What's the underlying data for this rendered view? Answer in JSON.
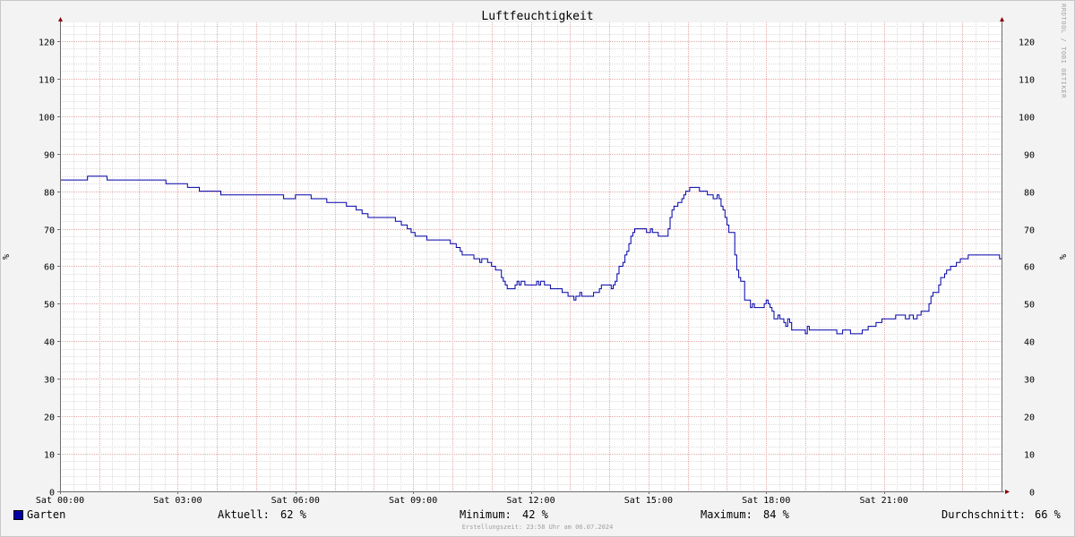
{
  "chart_data": {
    "type": "line",
    "title": "Luftfeuchtigkeit",
    "ylabel": "%",
    "y_ticks": [
      0,
      10,
      20,
      30,
      40,
      50,
      60,
      70,
      80,
      90,
      100,
      110,
      120
    ],
    "ylim": [
      0,
      125
    ],
    "xlim": [
      0,
      24
    ],
    "x_tick_labels": [
      "Sat 00:00",
      "Sat 03:00",
      "Sat 06:00",
      "Sat 09:00",
      "Sat 12:00",
      "Sat 15:00",
      "Sat 18:00",
      "Sat 21:00"
    ],
    "x_tick_hours": [
      0,
      3,
      6,
      9,
      12,
      15,
      18,
      21
    ],
    "grid": true,
    "series": [
      {
        "name": "Garten",
        "color": "#0000aa",
        "points": [
          [
            0.0,
            83
          ],
          [
            0.7,
            83
          ],
          [
            0.7,
            84
          ],
          [
            1.2,
            84
          ],
          [
            1.2,
            83
          ],
          [
            2.7,
            83
          ],
          [
            2.7,
            82
          ],
          [
            3.25,
            82
          ],
          [
            3.25,
            81
          ],
          [
            3.55,
            81
          ],
          [
            3.55,
            80
          ],
          [
            4.1,
            80
          ],
          [
            4.1,
            79
          ],
          [
            5.7,
            79
          ],
          [
            5.7,
            78
          ],
          [
            6.0,
            78
          ],
          [
            6.0,
            79
          ],
          [
            6.4,
            79
          ],
          [
            6.4,
            78
          ],
          [
            6.8,
            78
          ],
          [
            6.8,
            77
          ],
          [
            7.3,
            77
          ],
          [
            7.3,
            76
          ],
          [
            7.55,
            76
          ],
          [
            7.55,
            75
          ],
          [
            7.7,
            75
          ],
          [
            7.7,
            74
          ],
          [
            7.85,
            74
          ],
          [
            7.85,
            73
          ],
          [
            8.55,
            73
          ],
          [
            8.55,
            72
          ],
          [
            8.7,
            72
          ],
          [
            8.7,
            71
          ],
          [
            8.85,
            71
          ],
          [
            8.85,
            70
          ],
          [
            8.95,
            70
          ],
          [
            8.95,
            69
          ],
          [
            9.05,
            69
          ],
          [
            9.05,
            68
          ],
          [
            9.35,
            68
          ],
          [
            9.35,
            67
          ],
          [
            9.95,
            67
          ],
          [
            9.95,
            66
          ],
          [
            10.1,
            66
          ],
          [
            10.1,
            65
          ],
          [
            10.2,
            65
          ],
          [
            10.2,
            64
          ],
          [
            10.25,
            64
          ],
          [
            10.25,
            63
          ],
          [
            10.55,
            63
          ],
          [
            10.55,
            62
          ],
          [
            10.7,
            62
          ],
          [
            10.7,
            61
          ],
          [
            10.75,
            61
          ],
          [
            10.75,
            62
          ],
          [
            10.9,
            62
          ],
          [
            10.9,
            61
          ],
          [
            11.0,
            61
          ],
          [
            11.0,
            60
          ],
          [
            11.1,
            60
          ],
          [
            11.1,
            59
          ],
          [
            11.25,
            59
          ],
          [
            11.25,
            57
          ],
          [
            11.3,
            57
          ],
          [
            11.3,
            56
          ],
          [
            11.35,
            56
          ],
          [
            11.35,
            55
          ],
          [
            11.4,
            55
          ],
          [
            11.4,
            54
          ],
          [
            11.6,
            54
          ],
          [
            11.6,
            55
          ],
          [
            11.65,
            55
          ],
          [
            11.65,
            56
          ],
          [
            11.7,
            56
          ],
          [
            11.7,
            55
          ],
          [
            11.75,
            55
          ],
          [
            11.75,
            56
          ],
          [
            11.85,
            56
          ],
          [
            11.85,
            55
          ],
          [
            12.15,
            55
          ],
          [
            12.15,
            56
          ],
          [
            12.2,
            56
          ],
          [
            12.2,
            55
          ],
          [
            12.25,
            55
          ],
          [
            12.25,
            56
          ],
          [
            12.35,
            56
          ],
          [
            12.35,
            55
          ],
          [
            12.5,
            55
          ],
          [
            12.5,
            54
          ],
          [
            12.8,
            54
          ],
          [
            12.8,
            53
          ],
          [
            12.95,
            53
          ],
          [
            12.95,
            52
          ],
          [
            13.1,
            52
          ],
          [
            13.1,
            51
          ],
          [
            13.15,
            51
          ],
          [
            13.15,
            52
          ],
          [
            13.25,
            52
          ],
          [
            13.25,
            53
          ],
          [
            13.3,
            53
          ],
          [
            13.3,
            52
          ],
          [
            13.6,
            52
          ],
          [
            13.6,
            53
          ],
          [
            13.75,
            53
          ],
          [
            13.75,
            54
          ],
          [
            13.8,
            54
          ],
          [
            13.8,
            55
          ],
          [
            14.05,
            55
          ],
          [
            14.05,
            54
          ],
          [
            14.1,
            54
          ],
          [
            14.1,
            55
          ],
          [
            14.15,
            55
          ],
          [
            14.15,
            56
          ],
          [
            14.2,
            56
          ],
          [
            14.2,
            58
          ],
          [
            14.25,
            58
          ],
          [
            14.25,
            60
          ],
          [
            14.35,
            60
          ],
          [
            14.35,
            61
          ],
          [
            14.4,
            61
          ],
          [
            14.4,
            63
          ],
          [
            14.45,
            63
          ],
          [
            14.45,
            64
          ],
          [
            14.5,
            64
          ],
          [
            14.5,
            66
          ],
          [
            14.55,
            66
          ],
          [
            14.55,
            68
          ],
          [
            14.6,
            68
          ],
          [
            14.6,
            69
          ],
          [
            14.65,
            69
          ],
          [
            14.65,
            70
          ],
          [
            14.95,
            70
          ],
          [
            14.95,
            69
          ],
          [
            15.05,
            69
          ],
          [
            15.05,
            70
          ],
          [
            15.1,
            70
          ],
          [
            15.1,
            69
          ],
          [
            15.25,
            69
          ],
          [
            15.25,
            68
          ],
          [
            15.5,
            68
          ],
          [
            15.5,
            70
          ],
          [
            15.55,
            70
          ],
          [
            15.55,
            73
          ],
          [
            15.6,
            73
          ],
          [
            15.6,
            75
          ],
          [
            15.65,
            75
          ],
          [
            15.65,
            76
          ],
          [
            15.75,
            76
          ],
          [
            15.75,
            77
          ],
          [
            15.85,
            77
          ],
          [
            15.85,
            78
          ],
          [
            15.9,
            78
          ],
          [
            15.9,
            79
          ],
          [
            15.95,
            79
          ],
          [
            15.95,
            80
          ],
          [
            16.05,
            80
          ],
          [
            16.05,
            81
          ],
          [
            16.3,
            81
          ],
          [
            16.3,
            80
          ],
          [
            16.5,
            80
          ],
          [
            16.5,
            79
          ],
          [
            16.65,
            79
          ],
          [
            16.65,
            78
          ],
          [
            16.75,
            78
          ],
          [
            16.75,
            79
          ],
          [
            16.8,
            79
          ],
          [
            16.8,
            78
          ],
          [
            16.85,
            78
          ],
          [
            16.85,
            76
          ],
          [
            16.9,
            76
          ],
          [
            16.9,
            75
          ],
          [
            16.95,
            75
          ],
          [
            16.95,
            73
          ],
          [
            17.0,
            73
          ],
          [
            17.0,
            71
          ],
          [
            17.05,
            71
          ],
          [
            17.05,
            69
          ],
          [
            17.2,
            69
          ],
          [
            17.2,
            63
          ],
          [
            17.25,
            63
          ],
          [
            17.25,
            59
          ],
          [
            17.3,
            59
          ],
          [
            17.3,
            57
          ],
          [
            17.35,
            57
          ],
          [
            17.35,
            56
          ],
          [
            17.45,
            56
          ],
          [
            17.45,
            51
          ],
          [
            17.6,
            51
          ],
          [
            17.6,
            49
          ],
          [
            17.65,
            49
          ],
          [
            17.65,
            50
          ],
          [
            17.7,
            50
          ],
          [
            17.7,
            49
          ],
          [
            17.95,
            49
          ],
          [
            17.95,
            50
          ],
          [
            18.0,
            50
          ],
          [
            18.0,
            51
          ],
          [
            18.05,
            51
          ],
          [
            18.05,
            50
          ],
          [
            18.1,
            50
          ],
          [
            18.1,
            49
          ],
          [
            18.15,
            49
          ],
          [
            18.15,
            48
          ],
          [
            18.2,
            48
          ],
          [
            18.2,
            46
          ],
          [
            18.3,
            46
          ],
          [
            18.3,
            47
          ],
          [
            18.35,
            47
          ],
          [
            18.35,
            46
          ],
          [
            18.45,
            46
          ],
          [
            18.45,
            45
          ],
          [
            18.5,
            45
          ],
          [
            18.5,
            44
          ],
          [
            18.55,
            44
          ],
          [
            18.55,
            46
          ],
          [
            18.6,
            46
          ],
          [
            18.6,
            45
          ],
          [
            18.65,
            45
          ],
          [
            18.65,
            43
          ],
          [
            19.0,
            43
          ],
          [
            19.0,
            42
          ],
          [
            19.05,
            42
          ],
          [
            19.05,
            44
          ],
          [
            19.1,
            44
          ],
          [
            19.1,
            43
          ],
          [
            19.8,
            43
          ],
          [
            19.8,
            42
          ],
          [
            19.95,
            42
          ],
          [
            19.95,
            43
          ],
          [
            20.15,
            43
          ],
          [
            20.15,
            42
          ],
          [
            20.45,
            42
          ],
          [
            20.45,
            43
          ],
          [
            20.6,
            43
          ],
          [
            20.6,
            44
          ],
          [
            20.8,
            44
          ],
          [
            20.8,
            45
          ],
          [
            20.95,
            45
          ],
          [
            20.95,
            46
          ],
          [
            21.3,
            46
          ],
          [
            21.3,
            47
          ],
          [
            21.55,
            47
          ],
          [
            21.55,
            46
          ],
          [
            21.65,
            46
          ],
          [
            21.65,
            47
          ],
          [
            21.75,
            47
          ],
          [
            21.75,
            46
          ],
          [
            21.85,
            46
          ],
          [
            21.85,
            47
          ],
          [
            21.95,
            47
          ],
          [
            21.95,
            48
          ],
          [
            22.15,
            48
          ],
          [
            22.15,
            50
          ],
          [
            22.2,
            50
          ],
          [
            22.2,
            52
          ],
          [
            22.25,
            52
          ],
          [
            22.25,
            53
          ],
          [
            22.4,
            53
          ],
          [
            22.4,
            55
          ],
          [
            22.45,
            55
          ],
          [
            22.45,
            57
          ],
          [
            22.55,
            57
          ],
          [
            22.55,
            58
          ],
          [
            22.6,
            58
          ],
          [
            22.6,
            59
          ],
          [
            22.7,
            59
          ],
          [
            22.7,
            60
          ],
          [
            22.85,
            60
          ],
          [
            22.85,
            61
          ],
          [
            22.95,
            61
          ],
          [
            22.95,
            62
          ],
          [
            23.15,
            62
          ],
          [
            23.15,
            63
          ],
          [
            23.95,
            63
          ],
          [
            23.95,
            62
          ],
          [
            24.0,
            62
          ]
        ]
      }
    ]
  },
  "legend": {
    "series_name": "Garten",
    "aktuell_label": "Aktuell:",
    "aktuell_value": "62 %",
    "minimum_label": "Minimum:",
    "minimum_value": "42 %",
    "maximum_label": "Maximum:",
    "maximum_value": "84 %",
    "durchschnitt_label": "Durchschnitt:",
    "durchschnitt_value": "66 %"
  },
  "footer": "Erstellungszeit: 23:58 Uhr am 06.07.2024",
  "watermark": "RRDTOOL / TOBI OETIKER"
}
